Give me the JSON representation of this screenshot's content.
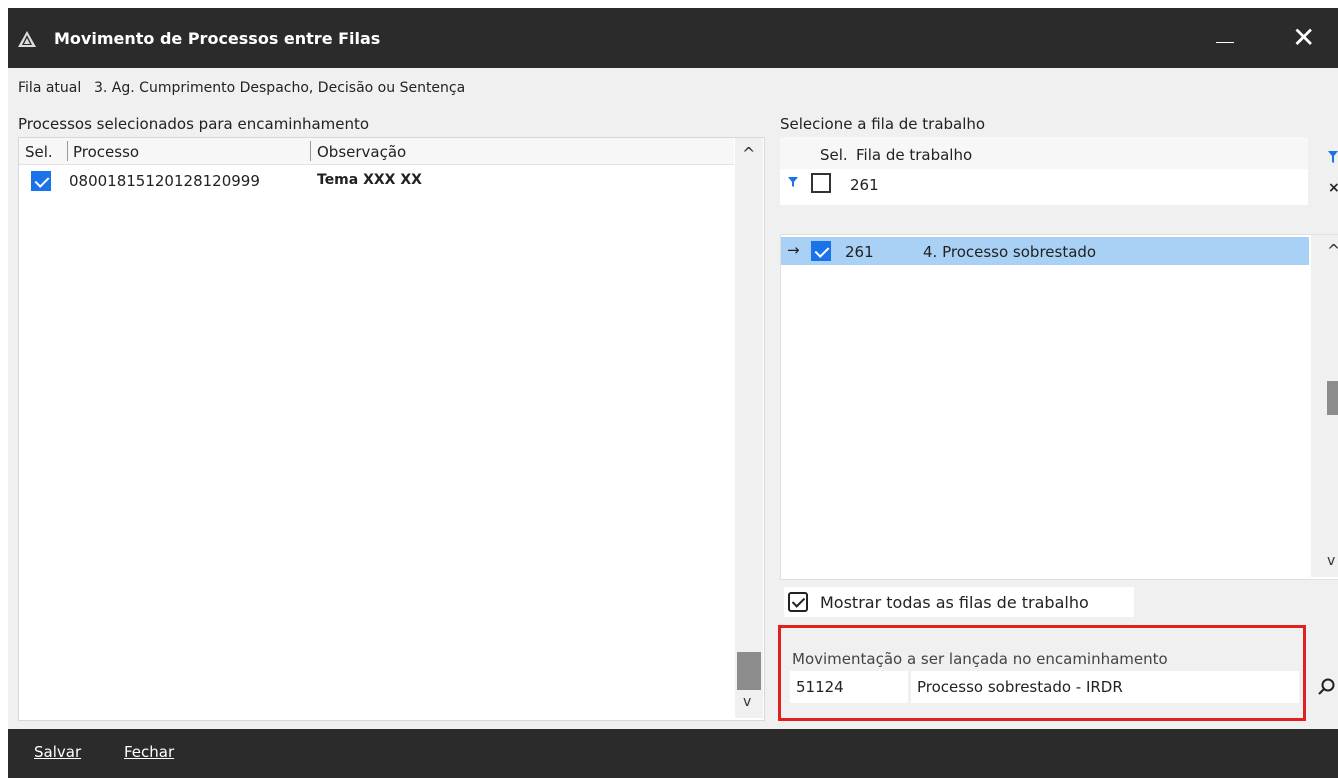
{
  "window": {
    "title": "Movimento de Processos entre Filas",
    "minimize_glyph": "—",
    "close_glyph": "✕"
  },
  "current_queue": {
    "label": "Fila atual",
    "value": "3. Ag. Cumprimento Despacho, Decisão ou Sentença"
  },
  "left_panel": {
    "title": "Processos selecionados para encaminhamento",
    "columns": [
      "Sel.",
      "Processo",
      "Observação"
    ],
    "rows": [
      {
        "selected": true,
        "processo": "08001815120128120999",
        "observacao": "Tema XXX XX"
      }
    ],
    "scroll_up": "^",
    "scroll_down": "v"
  },
  "right_panel": {
    "title": "Selecione a fila de trabalho",
    "columns": [
      "Sel.",
      "Fila de trabalho"
    ],
    "filter_value": "261",
    "rows": [
      {
        "current": true,
        "selected": true,
        "code": "261",
        "name": "4. Processo sobrestado"
      }
    ],
    "show_all_label": "Mostrar todas as filas de trabalho",
    "show_all_checked": true
  },
  "movement": {
    "label": "Movimentação a ser lançada no encaminhamento",
    "code": "51124",
    "description": "Processo sobrestado - IRDR",
    "search_icon": "search-icon"
  },
  "footer": {
    "save_label": "Salvar",
    "close_label": "Fechar"
  },
  "colors": {
    "titlebar": "#2b2b2b",
    "accent": "#1a73e8",
    "selected_row": "#a9d0f5",
    "highlight_box": "#e32020"
  }
}
